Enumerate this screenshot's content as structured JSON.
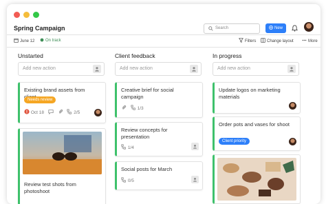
{
  "window": {
    "controls": [
      "close",
      "minimize",
      "zoom"
    ]
  },
  "project": {
    "title": "Spring Campaign",
    "date": "June 12",
    "status": "On track",
    "status_color": "#3e8e57"
  },
  "header": {
    "search_placeholder": "Search",
    "new_label": "New",
    "accent": "#2d7ff9"
  },
  "toolbar": {
    "filters": "Filters",
    "change_layout": "Change layout",
    "more": "More"
  },
  "columns": [
    {
      "title": "Unstarted",
      "add_placeholder": "Add new action",
      "cards": [
        {
          "title": "Existing brand assets from client",
          "badge": "Needs review",
          "badge_color": "#f5a623",
          "due": "Oct 18",
          "subtasks": "2/5",
          "icons": [
            "alert-icon",
            "comment-icon",
            "attachment-icon",
            "subtask-icon"
          ]
        },
        {
          "title": "Review test shots from photoshoot",
          "image": "sunglasses-photo"
        }
      ]
    },
    {
      "title": "Client feedback",
      "add_placeholder": "Add new action",
      "cards": [
        {
          "title": "Creative brief for social campaign",
          "subtasks": "1/3",
          "icons": [
            "attachment-icon",
            "subtask-icon"
          ]
        },
        {
          "title": "Review concepts for presentation",
          "subtasks": "1/4",
          "icons": [
            "subtask-icon"
          ]
        },
        {
          "title": "Social posts for March",
          "subtasks": "0/5",
          "icons": [
            "subtask-icon"
          ]
        }
      ]
    },
    {
      "title": "In progress",
      "add_placeholder": "Add new action",
      "cards": [
        {
          "title": "Update logos on marketing materials"
        },
        {
          "title": "Order pots and vases for shoot",
          "badge": "Client priority",
          "badge_color": "#2d7ff9"
        },
        {
          "image": "flatlay-photo"
        }
      ]
    }
  ],
  "card_accent": "#3ec16b"
}
